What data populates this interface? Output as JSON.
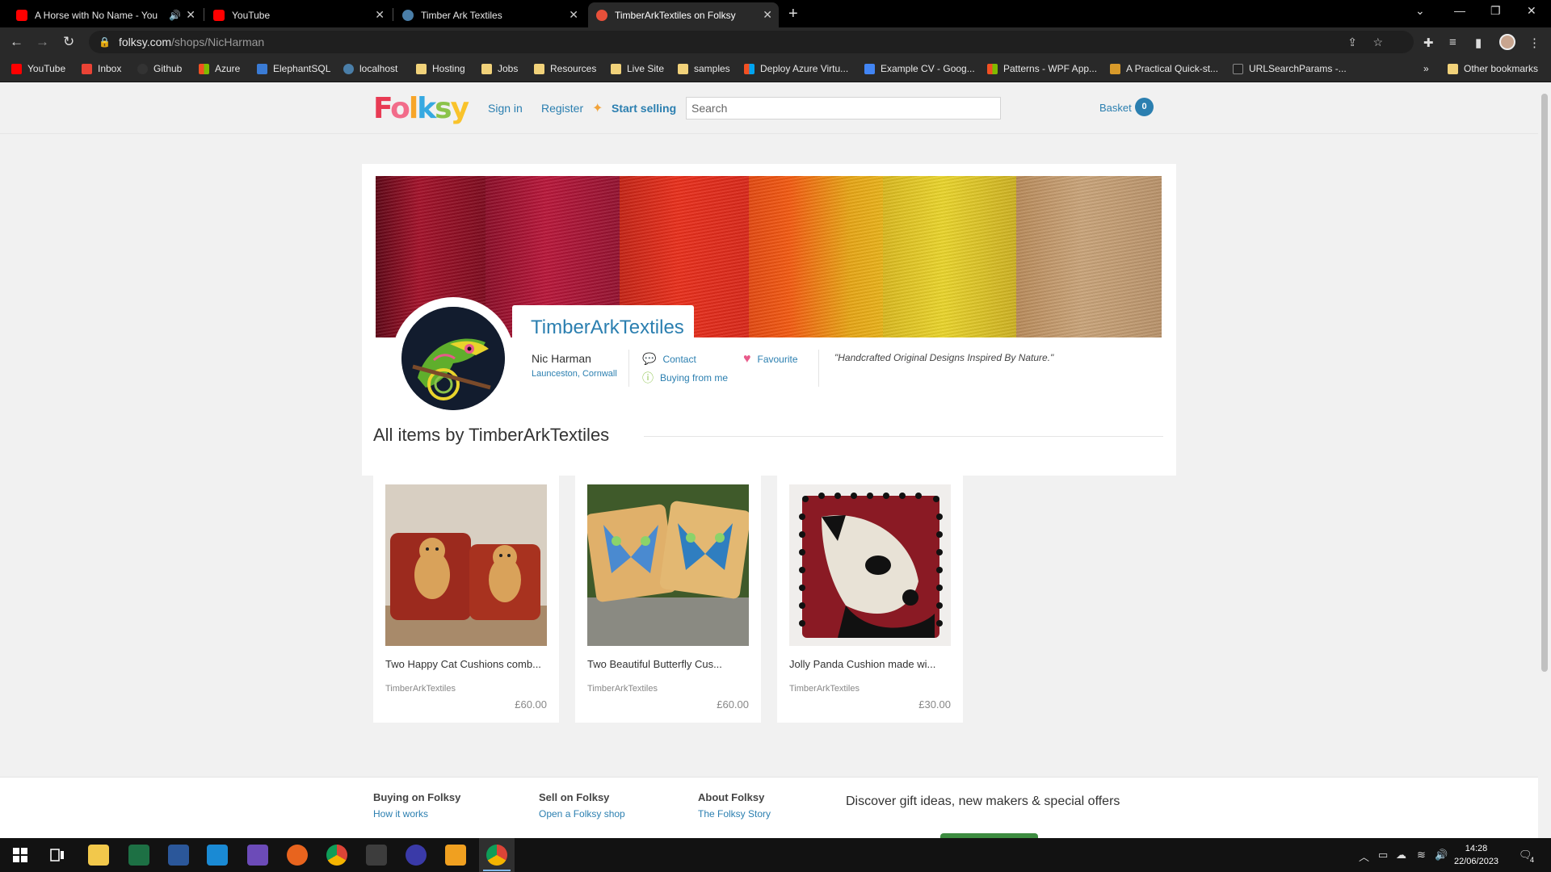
{
  "browser": {
    "tabs": [
      {
        "title": "A Horse with No Name - You",
        "favicon": "youtube-icon",
        "color": "#ff0000",
        "audio": true
      },
      {
        "title": "YouTube",
        "favicon": "youtube-icon",
        "color": "#ff0000"
      },
      {
        "title": "Timber Ark Textiles",
        "favicon": "site-icon",
        "color": "#4a7ea8"
      },
      {
        "title": "TimberArkTextiles on Folksy",
        "favicon": "folksy-icon",
        "color": "#e8503a",
        "active": true
      }
    ],
    "url_host": "folksy.com",
    "url_path": "/shops/NicHarman",
    "bookmarks": [
      "YouTube",
      "Inbox",
      "Github",
      "Azure",
      "ElephantSQL",
      "localhost",
      "Hosting",
      "Jobs",
      "Resources",
      "Live Site",
      "samples",
      "Deploy Azure Virtu...",
      "Example CV - Goog...",
      "Patterns - WPF App...",
      "A Practical Quick-st...",
      "URLSearchParams -..."
    ],
    "bookmarks_overflow": "»",
    "other_bookmarks": "Other bookmarks"
  },
  "header": {
    "logo": "Folksy",
    "sign_in": "Sign in",
    "register": "Register",
    "start_selling": "Start selling",
    "search_placeholder": "Search",
    "basket": "Basket",
    "basket_count": "0"
  },
  "shop": {
    "name": "TimberArkTextiles",
    "owner": "Nic Harman",
    "location": "Launceston, Cornwall",
    "contact": "Contact",
    "buying": "Buying from me",
    "favourite": "Favourite",
    "tagline": "\"Handcrafted Original Designs Inspired By Nature.\"",
    "banner_colors": [
      "#a3122a",
      "#b8173a",
      "#e8301c",
      "#f25a12",
      "#e8b21a",
      "#e9d42c",
      "#c9a47a"
    ]
  },
  "items_title": "All items by TimberArkTextiles",
  "products": [
    {
      "title": "Two Happy Cat Cushions comb...",
      "shop": "TimberArkTextiles",
      "price": "£60.00"
    },
    {
      "title": "Two Beautiful Butterfly Cus...",
      "shop": "TimberArkTextiles",
      "price": "£60.00"
    },
    {
      "title": "Jolly Panda Cushion made wi...",
      "shop": "TimberArkTextiles",
      "price": "£30.00"
    }
  ],
  "footer": {
    "col1_head": "Buying on Folksy",
    "col1_link": "How it works",
    "col2_head": "Sell on Folksy",
    "col2_link": "Open a Folksy shop",
    "col3_head": "About Folksy",
    "col3_link": "The Folksy Story",
    "discover": "Discover gift ideas, new makers & special offers"
  },
  "taskbar": {
    "time": "14:28",
    "date": "22/06/2023",
    "notifications": "4"
  }
}
